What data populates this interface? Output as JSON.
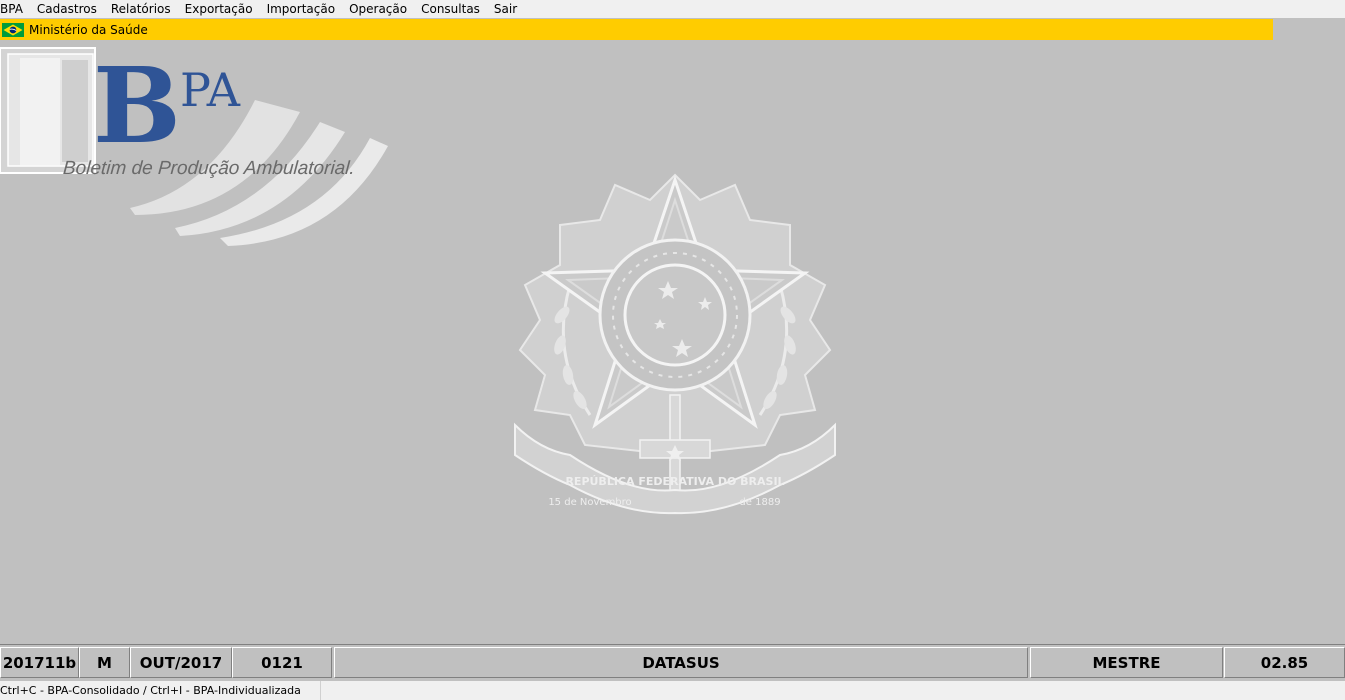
{
  "menu": {
    "items": [
      "BPA",
      "Cadastros",
      "Relatórios",
      "Exportação",
      "Importação",
      "Operação",
      "Consultas",
      "Sair"
    ]
  },
  "header": {
    "ministry": "Ministério da Saúde",
    "bar_color": "#ffcc00"
  },
  "logo": {
    "title": "BPA",
    "subtitle": "Boletim de Produção Ambulatorial."
  },
  "emblem": {
    "banner_text": "REPÚBLICA FEDERATIVA DO BRASIL",
    "left_ribbon": "15 de Novembro",
    "right_ribbon": "de 1889"
  },
  "status": {
    "version_code": "201711b",
    "mode": "M",
    "competence": "OUT/2017",
    "code": "0121",
    "org": "DATASUS",
    "user": "MESTRE",
    "version": "02.85"
  },
  "hint": {
    "text": "Ctrl+C - BPA-Consolidado / Ctrl+I - BPA-Individualizada"
  }
}
